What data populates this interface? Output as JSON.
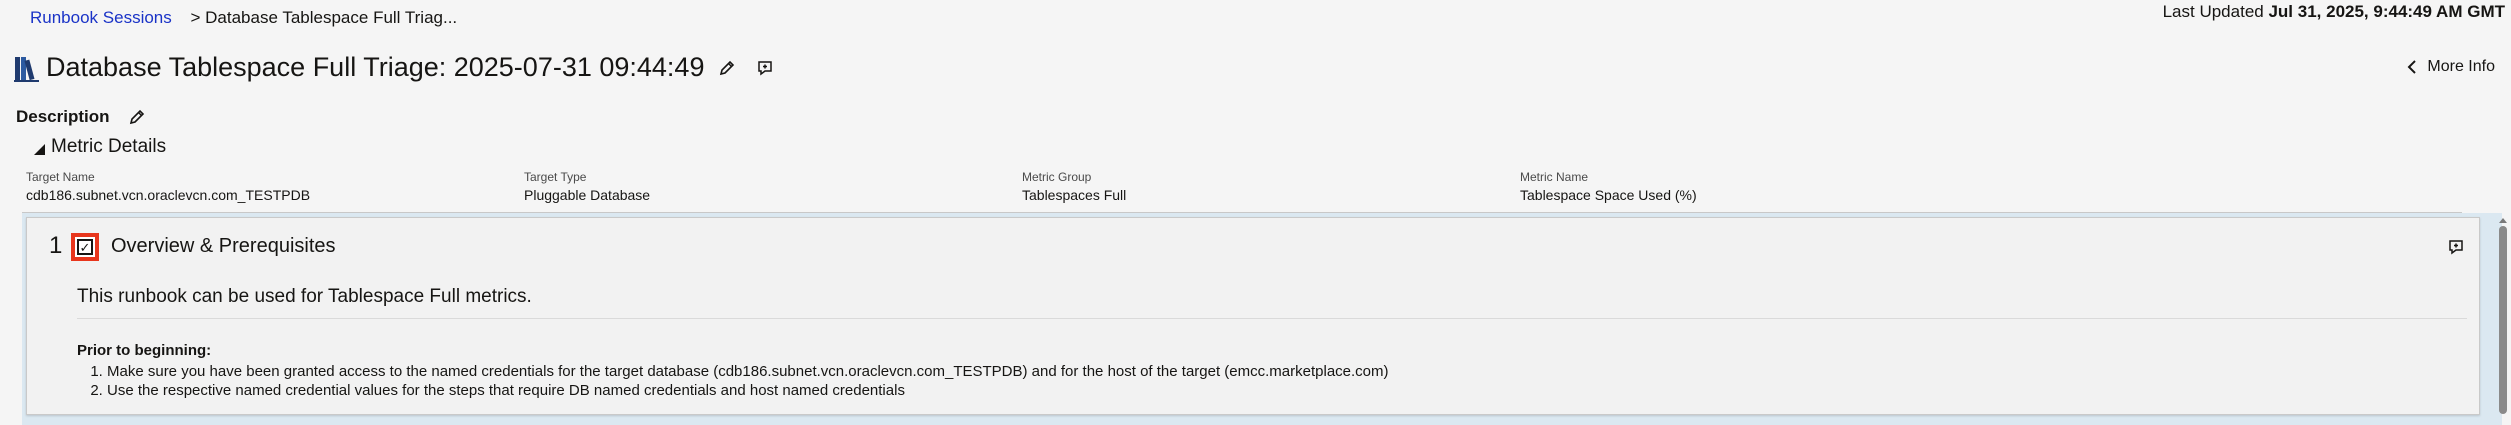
{
  "breadcrumb": {
    "link_label": "Runbook Sessions",
    "current": "> Database Tablespace Full Triag..."
  },
  "last_updated": {
    "label": "Last Updated",
    "value": "Jul 31, 2025, 9:44:49 AM GMT"
  },
  "header": {
    "title": "Database Tablespace Full Triage: 2025-07-31 09:44:49",
    "more_info_label": "More Info"
  },
  "description": {
    "label": "Description"
  },
  "metric_details": {
    "header": "Metric Details",
    "fields": [
      {
        "label": "Target Name",
        "value": "cdb186.subnet.vcn.oraclevcn.com_TESTPDB"
      },
      {
        "label": "Target Type",
        "value": "Pluggable Database"
      },
      {
        "label": "Metric Group",
        "value": "Tablespaces Full"
      },
      {
        "label": "Metric Name",
        "value": "Tablespace Space Used (%)"
      }
    ]
  },
  "step": {
    "number": "1",
    "checked": true,
    "title": "Overview & Prerequisites",
    "description": "This runbook can be used for Tablespace Full metrics.",
    "prior_heading": "Prior to beginning:",
    "prior_items": [
      "Make sure you have been granted access to the named credentials for the target database (cdb186.subnet.vcn.oraclevcn.com_TESTPDB) and for the host of the target (emcc.marketplace.com)",
      "Use the respective named credential values for the steps that require DB named credentials and host named credentials"
    ]
  },
  "colors": {
    "link": "#1a33c7",
    "highlight": "#e8361d",
    "steps_background": "#dbe8f1"
  },
  "icons": [
    "book-icon",
    "pencil-icon",
    "comment-icon",
    "chevron-left-icon",
    "collapse-triangle-icon",
    "checkbox-icon"
  ]
}
